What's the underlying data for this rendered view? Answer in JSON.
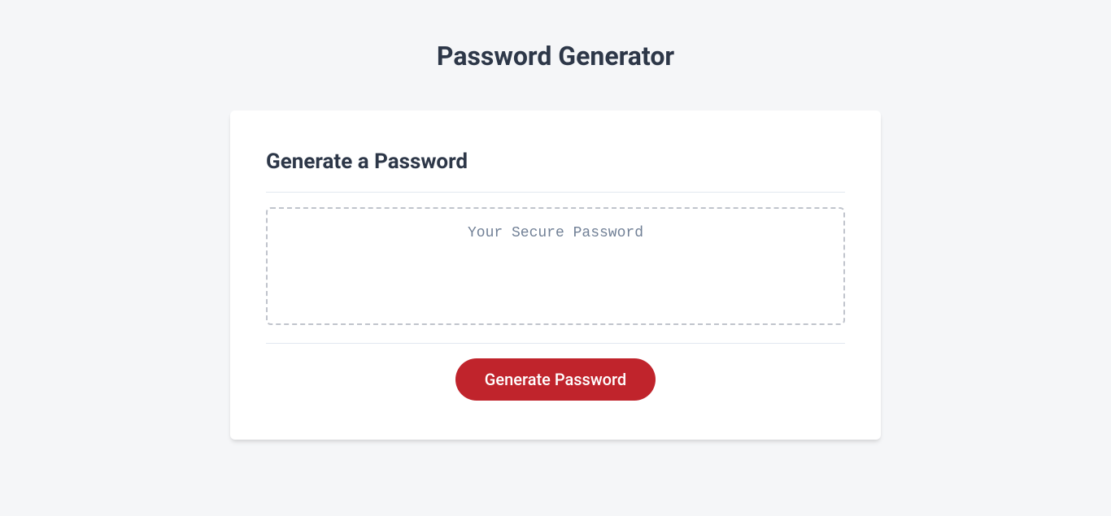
{
  "header": {
    "title": "Password Generator"
  },
  "card": {
    "title": "Generate a Password",
    "password_placeholder": "Your Secure Password",
    "password_value": "",
    "button_label": "Generate Password"
  }
}
